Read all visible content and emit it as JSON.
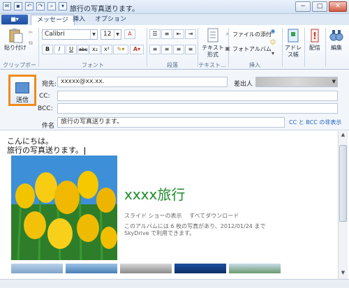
{
  "window": {
    "title": "旅行の写真送ります。",
    "minimize": "−",
    "maximize": "□",
    "close": "✕"
  },
  "tabs": {
    "app_menu": "■▾",
    "items": [
      "メッセージ",
      "挿入",
      "オプション"
    ]
  },
  "ribbon": {
    "clipboard": {
      "paste": "貼り付け",
      "label": "クリップボード"
    },
    "font": {
      "family": "Calibri",
      "size": "12",
      "label": "フォント",
      "bold": "B",
      "italic": "I",
      "underline": "U",
      "strike": "abc",
      "sub": "x₂",
      "sup": "x²"
    },
    "paragraph": {
      "label": "段落"
    },
    "text": {
      "plain": "テキスト形式",
      "label": "テキスト..."
    },
    "insert": {
      "attach": "ファイルの添付",
      "album": "フォトアルバム",
      "label": "挿入"
    },
    "addressbook": "アドレス帳",
    "priority": "配信",
    "edit": "編集"
  },
  "header": {
    "send": "送信",
    "to_label": "宛先:",
    "to_value": "xxxxx@xx.xx.",
    "from_label": "差出人",
    "cc_label": "CC:",
    "bcc_label": "BCC:",
    "subject_label": "件名",
    "subject_value": "旅行の写真送ります。",
    "cc_bcc_toggle": "CC と BCC の非表示"
  },
  "body": {
    "line1": "こんにちは。",
    "line2": "旅行の写真送ります。",
    "album_title": "xxxx旅行",
    "album_links": "スライド ショーの表示　 すべてダウンロード",
    "album_desc": "このアルバムには 6 枚の写真があり、2012/01/24 まで SkyDrive で利用できます。"
  }
}
